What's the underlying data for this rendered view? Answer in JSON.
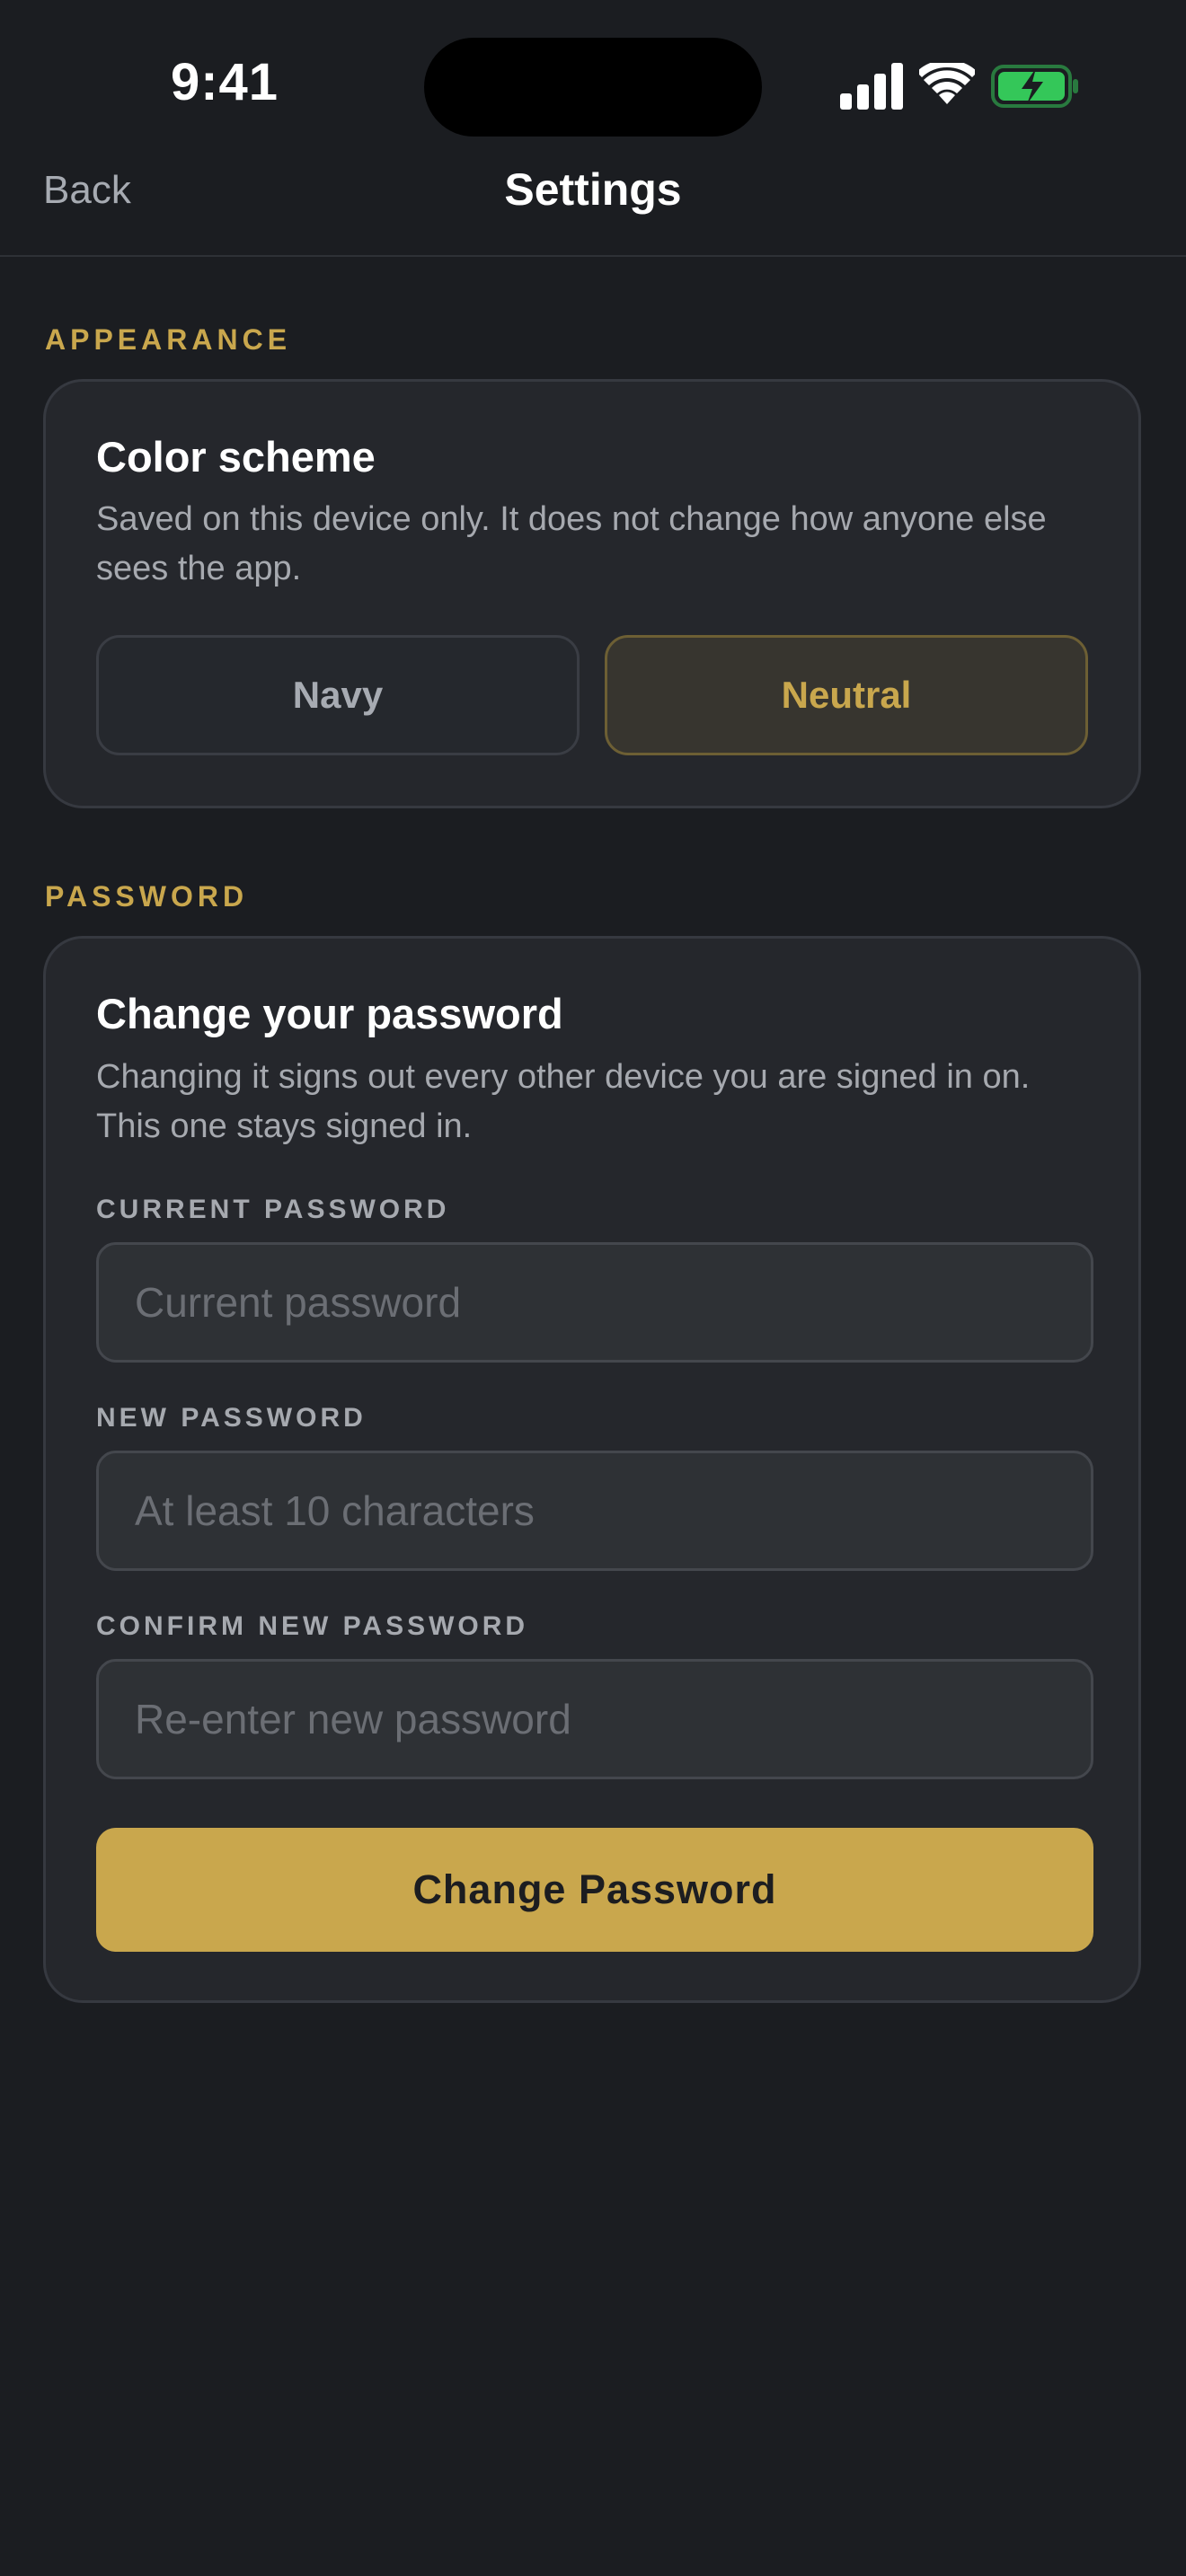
{
  "status_bar": {
    "time": "9:41",
    "icons": [
      "cellular-signal-icon",
      "wifi-icon",
      "battery-charging-icon"
    ],
    "battery_color": "#34c759"
  },
  "nav": {
    "back_label": "Back",
    "title": "Settings"
  },
  "appearance": {
    "section_label": "APPEARANCE",
    "card_title": "Color scheme",
    "description": "Saved on this device only. It does not change how anyone else sees the app.",
    "options": [
      {
        "label": "Navy",
        "selected": false
      },
      {
        "label": "Neutral",
        "selected": true
      }
    ]
  },
  "password": {
    "section_label": "PASSWORD",
    "card_title": "Change your password",
    "description": "Changing it signs out every other device you are signed in on. This one stays signed in.",
    "fields": [
      {
        "label": "CURRENT PASSWORD",
        "value": "",
        "placeholder": "Current password"
      },
      {
        "label": "NEW PASSWORD",
        "value": "",
        "placeholder": "At least 10 characters"
      },
      {
        "label": "CONFIRM NEW PASSWORD",
        "value": "",
        "placeholder": "Re-enter new password"
      }
    ],
    "submit_label": "Change Password"
  },
  "colors": {
    "background": "#1b1d21",
    "card": "#25272c",
    "accent": "#c9a74d",
    "muted_text": "#a6a9af"
  }
}
